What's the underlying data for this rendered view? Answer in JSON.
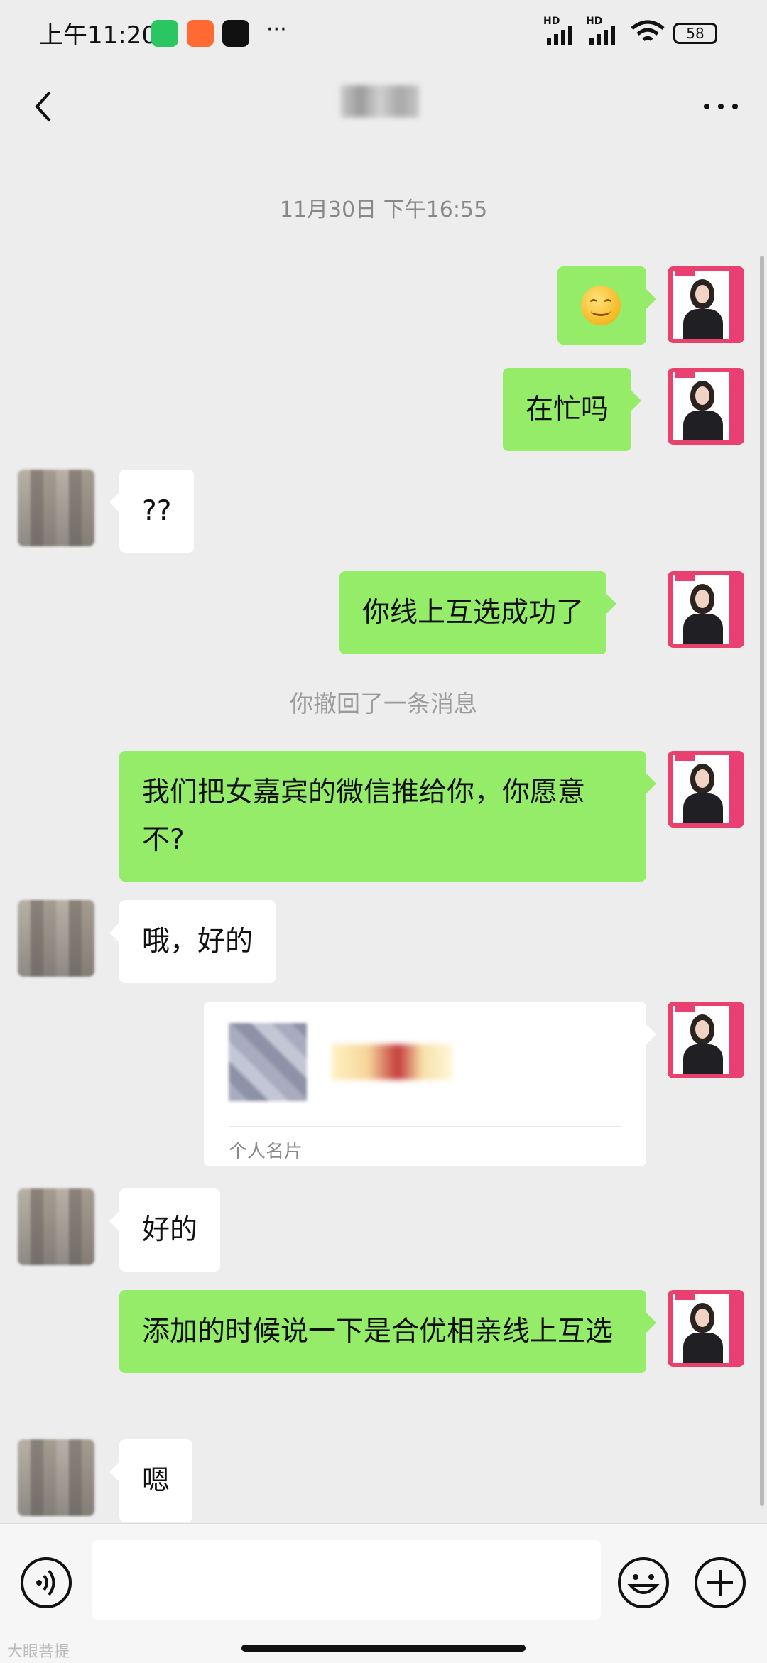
{
  "status_bar": {
    "time": "上午11:20",
    "more_glyph": "···",
    "signal_label_1": "HD",
    "signal_label_2": "HD",
    "battery": "58"
  },
  "header": {
    "back_glyph": "<",
    "more_glyph": "···"
  },
  "chat": {
    "timestamp": "11月30日 下午16:55",
    "recalled_notice": "你撤回了一条消息",
    "messages": [
      {
        "from": "me",
        "text": "😊",
        "kind": "emoji"
      },
      {
        "from": "me",
        "text": "在忙吗"
      },
      {
        "from": "other",
        "text": "??"
      },
      {
        "from": "me",
        "text": "你线上互选成功了"
      },
      {
        "from": "me",
        "text": "我们把女嘉宾的微信推给你，你愿意不?"
      },
      {
        "from": "other",
        "text": "哦，好的"
      },
      {
        "from": "me",
        "kind": "contact_card",
        "label": "个人名片"
      },
      {
        "from": "other",
        "text": "好的"
      },
      {
        "from": "me",
        "text": "添加的时候说一下是合优相亲线上互选"
      },
      {
        "from": "other",
        "text": "嗯"
      }
    ]
  },
  "input": {
    "placeholder": "",
    "watermark": "大眼菩提"
  }
}
